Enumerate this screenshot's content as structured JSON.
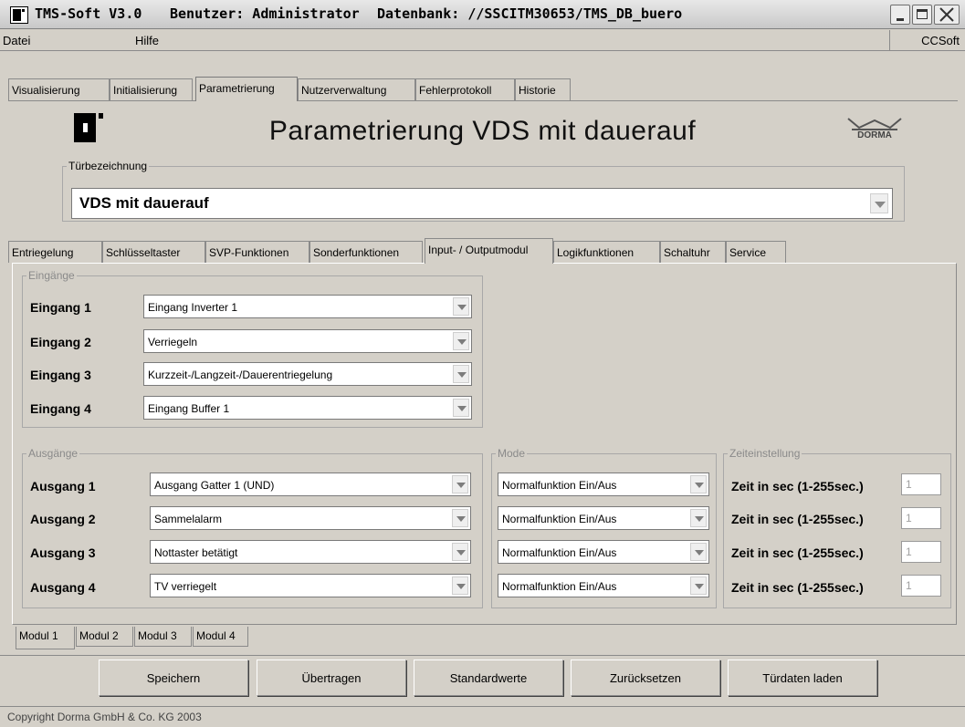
{
  "titlebar": {
    "app": "TMS-Soft V3.0",
    "user": "Benutzer: Administrator",
    "database": "Datenbank: //SSCITM30653/TMS_DB_buero"
  },
  "menu": {
    "items": [
      "Datei",
      "Hilfe"
    ],
    "right": "CCSoft"
  },
  "main_tabs": [
    "Visualisierung",
    "Initialisierung",
    "Parametrierung",
    "Nutzerverwaltung",
    "Fehlerprotokoll",
    "Historie"
  ],
  "main_tabs_active": "Parametrierung",
  "header": {
    "title": "Parametrierung  VDS mit dauerauf",
    "brand": "DORMA"
  },
  "door": {
    "legend": "Türbezeichnung",
    "value": "VDS mit dauerauf"
  },
  "sub_tabs": [
    "Entriegelung",
    "Schlüsseltaster",
    "SVP-Funktionen",
    "Sonderfunktionen",
    "Input- / Outputmodul",
    "Logikfunktionen",
    "Schaltuhr",
    "Service"
  ],
  "sub_tabs_active": "Input- / Outputmodul",
  "inputs": {
    "legend": "Eingänge",
    "rows": [
      {
        "label": "Eingang 1",
        "value": "Eingang Inverter 1"
      },
      {
        "label": "Eingang 2",
        "value": "Verriegeln"
      },
      {
        "label": "Eingang 3",
        "value": "Kurzzeit-/Langzeit-/Dauerentriegelung"
      },
      {
        "label": "Eingang 4",
        "value": "Eingang Buffer 1"
      }
    ]
  },
  "outputs": {
    "legend": "Ausgänge",
    "mode_legend": "Mode",
    "time_legend": "Zeiteinstellung",
    "rows": [
      {
        "label": "Ausgang 1",
        "value": "Ausgang Gatter 1 (UND)",
        "mode": "Normalfunktion Ein/Aus",
        "time_label": "Zeit in sec (1-255sec.)",
        "time_value": "1"
      },
      {
        "label": "Ausgang 2",
        "value": "Sammelalarm",
        "mode": "Normalfunktion Ein/Aus",
        "time_label": "Zeit in sec (1-255sec.)",
        "time_value": "1"
      },
      {
        "label": "Ausgang 3",
        "value": "Nottaster betätigt",
        "mode": "Normalfunktion Ein/Aus",
        "time_label": "Zeit in sec (1-255sec.)",
        "time_value": "1"
      },
      {
        "label": "Ausgang 4",
        "value": "TV verriegelt",
        "mode": "Normalfunktion Ein/Aus",
        "time_label": "Zeit in sec (1-255sec.)",
        "time_value": "1"
      }
    ]
  },
  "module_tabs": [
    "Modul 1",
    "Modul 2",
    "Modul 3",
    "Modul 4"
  ],
  "module_tabs_active": "Modul 1",
  "buttons": {
    "save": "Speichern",
    "transfer": "Übertragen",
    "defaults": "Standardwerte",
    "reset": "Zurücksetzen",
    "load": "Türdaten laden"
  },
  "status": {
    "copyright": "Copyright Dorma GmbH & Co. KG 2003"
  }
}
